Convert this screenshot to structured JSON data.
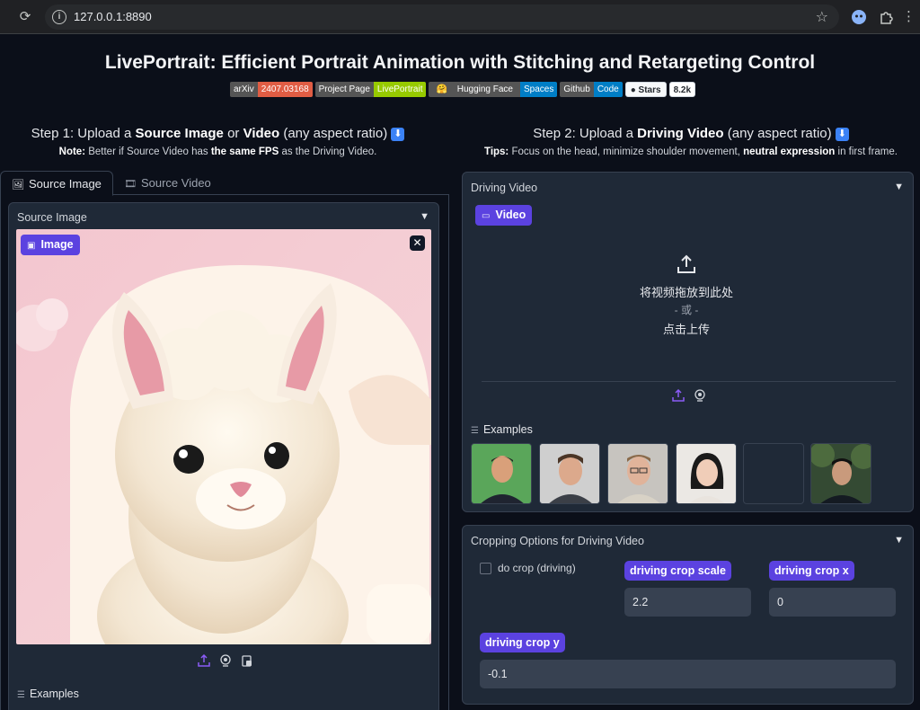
{
  "browser": {
    "url": "127.0.0.1:8890"
  },
  "header": {
    "title": "LivePortrait: Efficient Portrait Animation with Stitching and Retargeting Control",
    "badges": [
      {
        "left": "arXiv",
        "right": "2407.03168",
        "color": "#e05d44"
      },
      {
        "left": "Project Page",
        "right": "LivePortrait",
        "color": "#97ca00"
      },
      {
        "left": "Hugging Face",
        "right": "Spaces",
        "color": "#007ec6",
        "emoji": "🤗"
      },
      {
        "left": "Github",
        "right": "Code",
        "color": "#007ec6"
      }
    ],
    "stars_label": "Stars",
    "stars_count": "8.2k"
  },
  "step1": {
    "prefix": "Step 1: Upload a ",
    "bold1": "Source Image",
    "mid": " or ",
    "bold2": "Video",
    "suffix": " (any aspect ratio) ",
    "note_label": "Note:",
    "note_text1": " Better if Source Video has ",
    "note_bold": "the same FPS",
    "note_text2": " as the Driving Video."
  },
  "step2": {
    "prefix": "Step 2: Upload a ",
    "bold1": "Driving Video",
    "suffix": " (any aspect ratio) ",
    "tips_label": "Tips:",
    "tips_text1": " Focus on the head, minimize shoulder movement, ",
    "tips_bold": "neutral expression",
    "tips_text2": " in first frame."
  },
  "source_tabs": {
    "image_tab": "Source Image",
    "video_tab": "Source Video"
  },
  "source_image": {
    "block_label": "Source Image",
    "pill_label": "Image",
    "examples_label": "Examples"
  },
  "driving_video": {
    "block_label": "Driving Video",
    "pill_label": "Video",
    "drop_text": "将视频拖放到此处",
    "or_text": "- 或 -",
    "click_text": "点击上传",
    "examples_label": "Examples"
  },
  "cropping": {
    "block_label": "Cropping Options for Driving Video",
    "do_crop_label": "do crop (driving)",
    "do_crop_checked": false,
    "scale_label": "driving crop scale",
    "scale_value": "2.2",
    "x_label": "driving crop x",
    "x_value": "0",
    "y_label": "driving crop y",
    "y_value": "-0.1"
  },
  "colors": {
    "accent": "#5b42e0",
    "panel": "#1f2937",
    "background": "#0b0f19"
  }
}
